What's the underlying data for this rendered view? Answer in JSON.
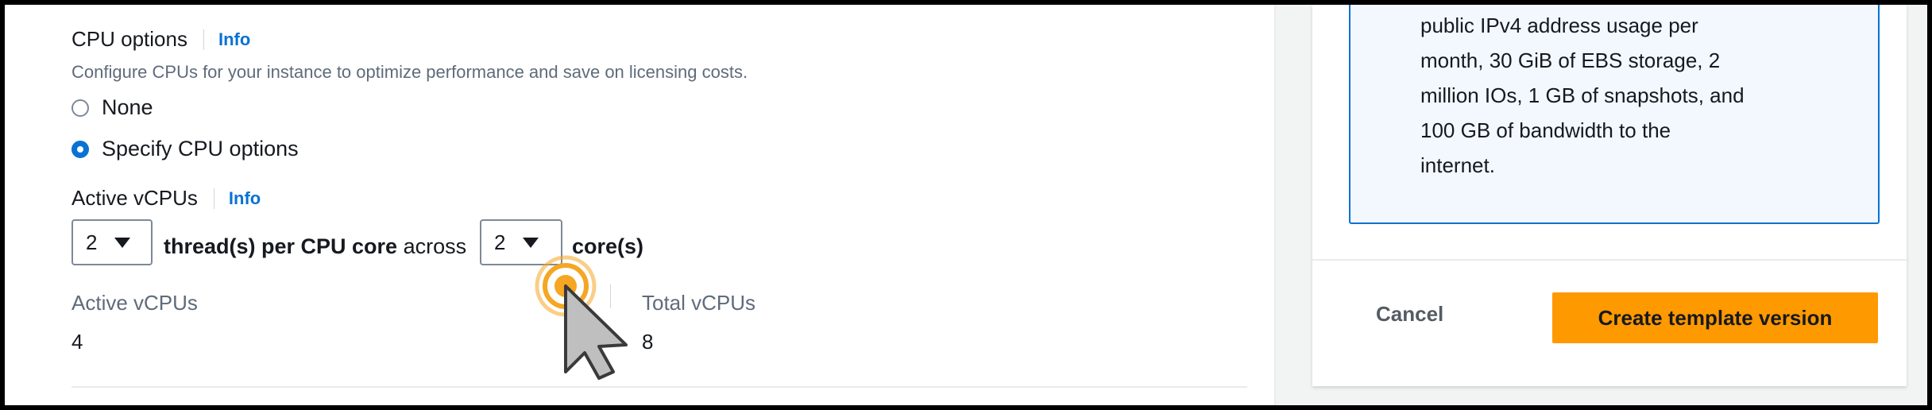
{
  "cpu_options": {
    "title": "CPU options",
    "info": "Info",
    "description": "Configure CPUs for your instance to optimize performance and save on licensing costs.",
    "radio_none": "None",
    "radio_specify": "Specify CPU options",
    "selected": "Specify CPU options"
  },
  "active_vcpus": {
    "label": "Active vCPUs",
    "info": "Info",
    "threads_value": "2",
    "threads_text": "thread(s) per CPU core",
    "across_text": "across",
    "cores_value": "2",
    "cores_text": "core(s)"
  },
  "summary": {
    "active_label": "Active vCPUs",
    "active_value": "4",
    "total_label": "Total vCPUs",
    "total_value": "8"
  },
  "side_panel": {
    "info_lines": [
      "public IPv4 address usage per",
      "month, 30 GiB of EBS storage, 2",
      "million IOs, 1 GB of snapshots, and",
      "100 GB of bandwidth to the",
      "internet."
    ],
    "cancel": "Cancel",
    "create": "Create template version"
  },
  "colors": {
    "accent": "#0972d3",
    "primary_button": "#ff9900",
    "cursor_ring": "#f5a623"
  },
  "icons": {
    "caret": "caret-down-icon",
    "cursor": "mouse-pointer-icon"
  }
}
